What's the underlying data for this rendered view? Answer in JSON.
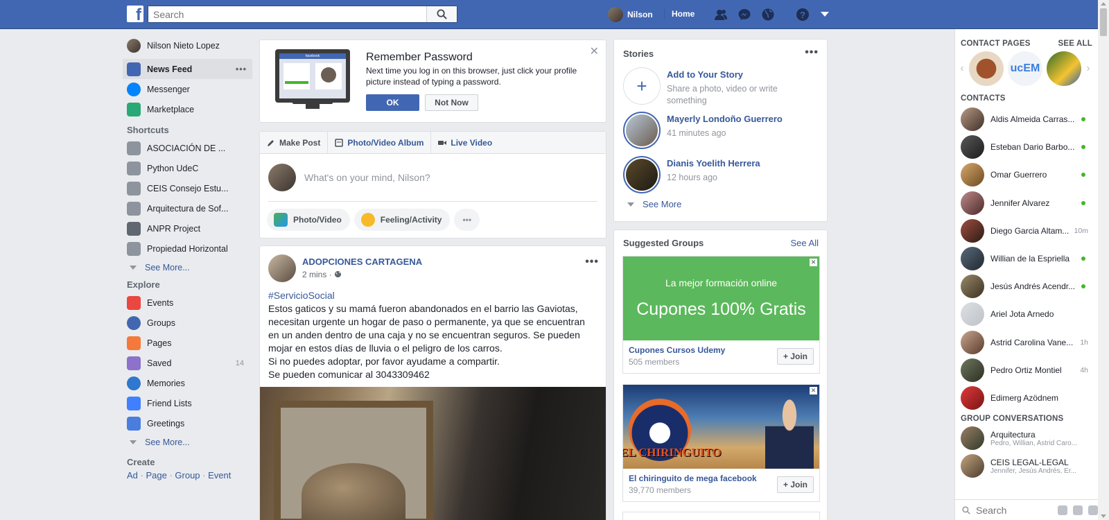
{
  "topbar": {
    "logo": "f",
    "search_placeholder": "Search",
    "user_name": "Nilson",
    "home": "Home",
    "icons": [
      "friends-icon",
      "messenger-icon",
      "globe-icon"
    ]
  },
  "left": {
    "profile_name": "Nilson Nieto Lopez",
    "main_items": [
      {
        "label": "News Feed",
        "color": "#4267b2"
      },
      {
        "label": "Messenger",
        "color": "#0084ff"
      },
      {
        "label": "Marketplace",
        "color": "#2aa876"
      }
    ],
    "shortcuts_title": "Shortcuts",
    "shortcuts": [
      {
        "label": "ASOCIACIÓN DE ..."
      },
      {
        "label": "Python UdeC"
      },
      {
        "label": "CEIS Consejo Estu..."
      },
      {
        "label": "Arquitectura de Sof..."
      },
      {
        "label": "ANPR Project"
      },
      {
        "label": "Propiedad Horizontal"
      }
    ],
    "see_more": "See More...",
    "explore_title": "Explore",
    "explore": [
      {
        "label": "Events",
        "count": "",
        "color": "#e9473f"
      },
      {
        "label": "Groups",
        "count": "",
        "color": "#4267b2"
      },
      {
        "label": "Pages",
        "count": "",
        "color": "#f5793a"
      },
      {
        "label": "Saved",
        "count": "14",
        "color": "#8c72cb"
      },
      {
        "label": "Memories",
        "count": "",
        "color": "#2f77cf"
      },
      {
        "label": "Friend Lists",
        "count": "",
        "color": "#4080ff"
      },
      {
        "label": "Greetings",
        "count": "",
        "color": "#4a7dde"
      }
    ],
    "see_more_2": "See More...",
    "create_title": "Create",
    "create_links": [
      "Ad",
      "Page",
      "Group",
      "Event"
    ]
  },
  "password": {
    "title": "Remember Password",
    "text": "Next time you log in on this browser, just click your profile picture instead of typing a password.",
    "ok": "OK",
    "not_now": "Not Now",
    "monitor_brand": "facebook"
  },
  "composer": {
    "tabs": [
      "Make Post",
      "Photo/Video Album",
      "Live Video"
    ],
    "placeholder": "What's on your mind, Nilson?",
    "buttons": [
      "Photo/Video",
      "Feeling/Activity"
    ]
  },
  "post": {
    "author": "ADOPCIONES CARTAGENA",
    "time": "2 mins ·",
    "hashtag": "#ServicioSocial",
    "lines": [
      "Estos gaticos y su mamá fueron abandonados en el barrio las Gaviotas,",
      "necesitan urgente un hogar de paso o permanente, ya que se encuentran",
      "en un anden dentro de una caja y no se encuentran seguros. Se pueden",
      "mojar en estos días de lluvia o el peligro de los carros.",
      "Si no puedes adoptar, por favor ayudame a compartir.",
      "Se pueden comunicar al 3043309462"
    ]
  },
  "stories": {
    "title": "Stories",
    "add_title": "Add to Your Story",
    "add_sub": "Share a photo, video or write something",
    "items": [
      {
        "name": "Mayerly Londoño Guerrero",
        "time": "41 minutes ago"
      },
      {
        "name": "Dianis Yoelith Herrera",
        "time": "12 hours ago"
      }
    ],
    "see_more": "See More"
  },
  "groups": {
    "title": "Suggested Groups",
    "see_all": "See All",
    "items": [
      {
        "name": "Cupones Cursos Udemy",
        "members": "505 members",
        "join": "Join",
        "ad_line1": "La mejor formación online",
        "ad_line2": "Cupones 100% Gratis"
      },
      {
        "name": "El chiringuito de mega facebook",
        "members": "39,770 members",
        "join": "Join",
        "ad_text": "EL CHIRINGUITO"
      }
    ]
  },
  "chat": {
    "contact_pages": "CONTACT PAGES",
    "see_all": "SEE ALL",
    "page_labels": [
      "",
      "ucEM",
      ""
    ],
    "contacts_title": "CONTACTS",
    "contacts": [
      {
        "name": "Aldis Almeida Carras...",
        "status": "online"
      },
      {
        "name": "Esteban Dario Barbo...",
        "status": "online"
      },
      {
        "name": "Omar Guerrero",
        "status": "online"
      },
      {
        "name": "Jennifer Alvarez",
        "status": "online"
      },
      {
        "name": "Diego Garcia Altam...",
        "status": "10m"
      },
      {
        "name": "Willian de la Espriella",
        "status": "online"
      },
      {
        "name": "Jesús Andrés Acendr...",
        "status": "online"
      },
      {
        "name": "Ariel Jota Arnedo",
        "status": ""
      },
      {
        "name": "Astrid Carolina Vane...",
        "status": "1h"
      },
      {
        "name": "Pedro Ortiz Montiel",
        "status": "4h"
      },
      {
        "name": "Edimerg Azödnem",
        "status": ""
      }
    ],
    "group_conv_title": "GROUP CONVERSATIONS",
    "groups": [
      {
        "name": "Arquitectura",
        "members": "Pedro, Willian, Astrid Caro..."
      },
      {
        "name": "CEIS LEGAL-LEGAL",
        "members": "Jennifer, Jesús Andrés, Er..."
      }
    ],
    "search_placeholder": "Search"
  }
}
